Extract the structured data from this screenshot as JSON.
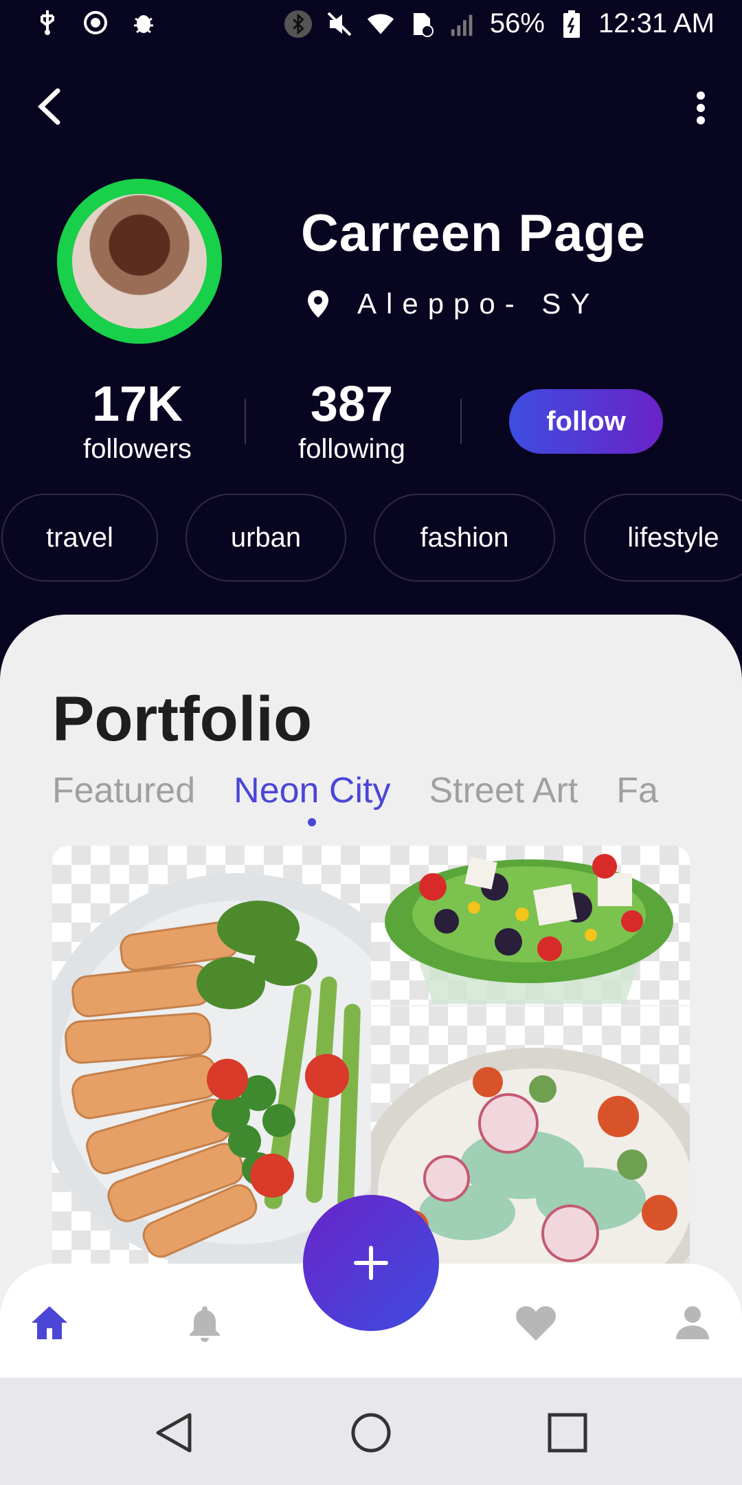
{
  "status_bar": {
    "battery": "56%",
    "time": "12:31 AM",
    "icons": [
      "usb-icon",
      "sync-icon",
      "debug-icon",
      "bluetooth-icon",
      "mute-icon",
      "wifi-icon",
      "sim-icon",
      "signal-icon",
      "battery-icon"
    ]
  },
  "profile": {
    "name": "Carreen Page",
    "location": "Aleppo- SY",
    "stats": [
      {
        "value": "17K",
        "label": "followers"
      },
      {
        "value": "387",
        "label": "following"
      }
    ],
    "follow_label": "follow"
  },
  "chips": [
    "travel",
    "urban",
    "fashion",
    "lifestyle"
  ],
  "portfolio": {
    "title": "Portfolio",
    "tabs": [
      "Featured",
      "Neon City",
      "Street Art",
      "Fa"
    ],
    "active_tab": "Neon City"
  },
  "bottom_nav": {
    "items": [
      "home-icon",
      "bell-icon",
      "heart-icon",
      "person-icon"
    ],
    "fab_icon": "plus-icon"
  },
  "colors": {
    "background": "#080520",
    "accent": "#4b46d6",
    "follow_gradient_start": "#3e4de0",
    "follow_gradient_end": "#6a23c8",
    "avatar_ring": "#18d04a"
  }
}
